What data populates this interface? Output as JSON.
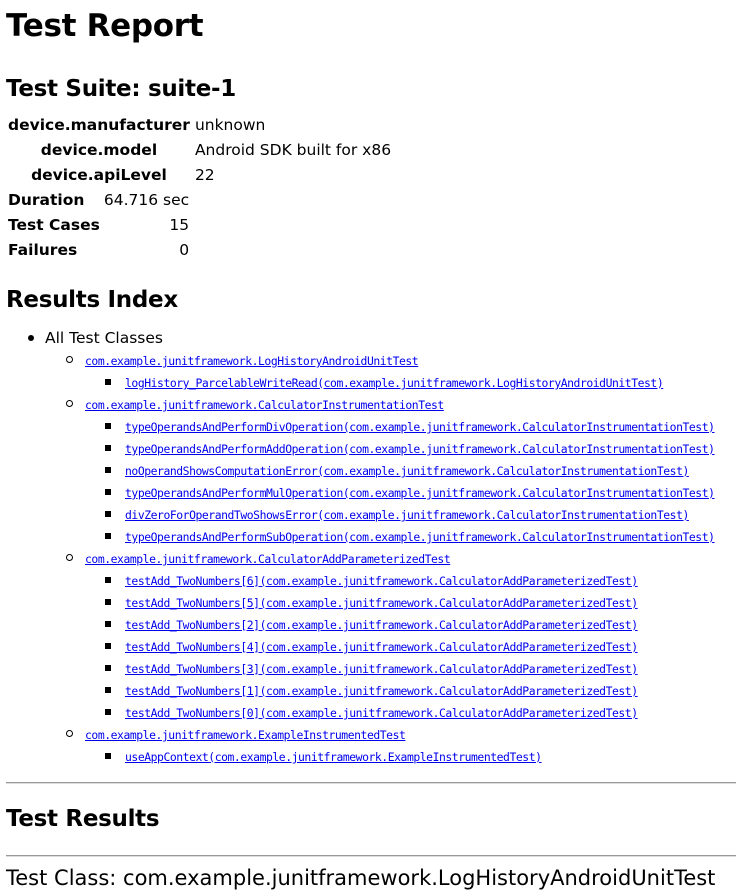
{
  "report": {
    "title": "Test Report",
    "suite_heading": "Test Suite: suite-1",
    "properties": [
      {
        "key": "device.manufacturer",
        "value": "unknown"
      },
      {
        "key": "device.model",
        "value": "Android SDK built for x86"
      },
      {
        "key": "device.apiLevel",
        "value": "22"
      }
    ],
    "stats": [
      {
        "key": "Duration",
        "value": "64.716 sec"
      },
      {
        "key": "Test Cases",
        "value": "15"
      },
      {
        "key": "Failures",
        "value": "0"
      }
    ],
    "index_heading": "Results Index",
    "all_classes_label": "All Test Classes",
    "classes": [
      {
        "name": "com.example.junitframework.LogHistoryAndroidUnitTest",
        "methods": [
          "logHistory_ParcelableWriteRead(com.example.junitframework.LogHistoryAndroidUnitTest)"
        ]
      },
      {
        "name": "com.example.junitframework.CalculatorInstrumentationTest",
        "methods": [
          "typeOperandsAndPerformDivOperation(com.example.junitframework.CalculatorInstrumentationTest)",
          "typeOperandsAndPerformAddOperation(com.example.junitframework.CalculatorInstrumentationTest)",
          "noOperandShowsComputationError(com.example.junitframework.CalculatorInstrumentationTest)",
          "typeOperandsAndPerformMulOperation(com.example.junitframework.CalculatorInstrumentationTest)",
          "divZeroForOperandTwoShowsError(com.example.junitframework.CalculatorInstrumentationTest)",
          "typeOperandsAndPerformSubOperation(com.example.junitframework.CalculatorInstrumentationTest)"
        ]
      },
      {
        "name": "com.example.junitframework.CalculatorAddParameterizedTest",
        "methods": [
          "testAdd_TwoNumbers[6](com.example.junitframework.CalculatorAddParameterizedTest)",
          "testAdd_TwoNumbers[5](com.example.junitframework.CalculatorAddParameterizedTest)",
          "testAdd_TwoNumbers[2](com.example.junitframework.CalculatorAddParameterizedTest)",
          "testAdd_TwoNumbers[4](com.example.junitframework.CalculatorAddParameterizedTest)",
          "testAdd_TwoNumbers[3](com.example.junitframework.CalculatorAddParameterizedTest)",
          "testAdd_TwoNumbers[1](com.example.junitframework.CalculatorAddParameterizedTest)",
          "testAdd_TwoNumbers[0](com.example.junitframework.CalculatorAddParameterizedTest)"
        ]
      },
      {
        "name": "com.example.junitframework.ExampleInstrumentedTest",
        "methods": [
          "useAppContext(com.example.junitframework.ExampleInstrumentedTest)"
        ]
      }
    ],
    "results_heading": "Test Results",
    "first_class_heading": "Test Class: com.example.junitframework.LogHistoryAndroidUnitTest",
    "colors": {
      "link": "#0000ee",
      "text": "#000000",
      "background": "#ffffff",
      "rule": "#999999"
    }
  }
}
